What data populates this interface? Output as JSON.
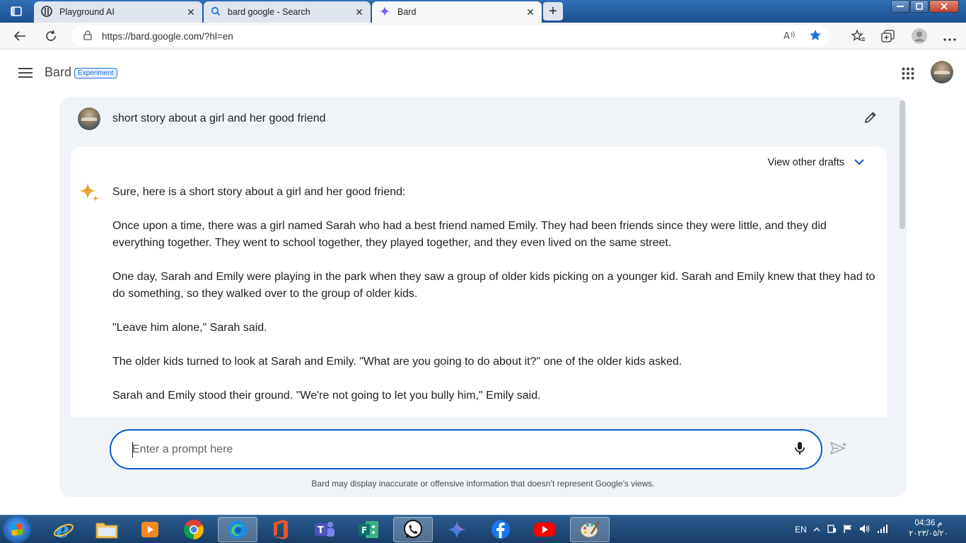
{
  "browser": {
    "tabs": [
      {
        "label": "Playground AI",
        "icon": "playground-ai-icon",
        "active": false
      },
      {
        "label": "bard google - Search",
        "icon": "search-icon",
        "active": false
      },
      {
        "label": "Bard",
        "icon": "bard-sparkle-icon",
        "active": true
      }
    ],
    "new_tab_label": "+",
    "url": "https://bard.google.com/?hl=en",
    "close_glyph": "✕"
  },
  "app": {
    "name": "Bard",
    "badge": "Experiment",
    "colors": {
      "accent": "#0b57d0",
      "panel_bg": "#f0f4f9",
      "spark": "#e8a53a"
    }
  },
  "conversation": {
    "prompt": "short story about a girl and her good friend",
    "view_drafts_label": "View other drafts",
    "response_paragraphs": [
      "Sure, here is a short story about a girl and her good friend:",
      "Once upon a time, there was a girl named Sarah who had a best friend named Emily. They had been friends since they were little, and they did everything together. They went to school together, they played together, and they even lived on the same street.",
      "One day, Sarah and Emily were playing in the park when they saw a group of older kids picking on a younger kid. Sarah and Emily knew that they had to do something, so they walked over to the group of older kids.",
      "\"Leave him alone,\" Sarah said.",
      "The older kids turned to look at Sarah and Emily. \"What are you going to do about it?\" one of the older kids asked.",
      "Sarah and Emily stood their ground. \"We're not going to let you bully him,\" Emily said."
    ]
  },
  "input": {
    "placeholder": "Enter a prompt here",
    "value": ""
  },
  "disclaimer": "Bard may display inaccurate or offensive information that doesn’t represent Google’s views.",
  "taskbar": {
    "apps": [
      "internet-explorer-icon",
      "file-explorer-icon",
      "media-player-icon",
      "chrome-icon",
      "edge-icon",
      "office-icon",
      "teams-icon",
      "forms-icon",
      "whatsapp-icon",
      "bard-app-icon",
      "facebook-icon",
      "youtube-icon",
      "paint-icon"
    ],
    "active_app": "edge-icon",
    "language": "EN",
    "time": "04:36 م",
    "date": "٢٠٢٣/٠٥/٢٠"
  }
}
